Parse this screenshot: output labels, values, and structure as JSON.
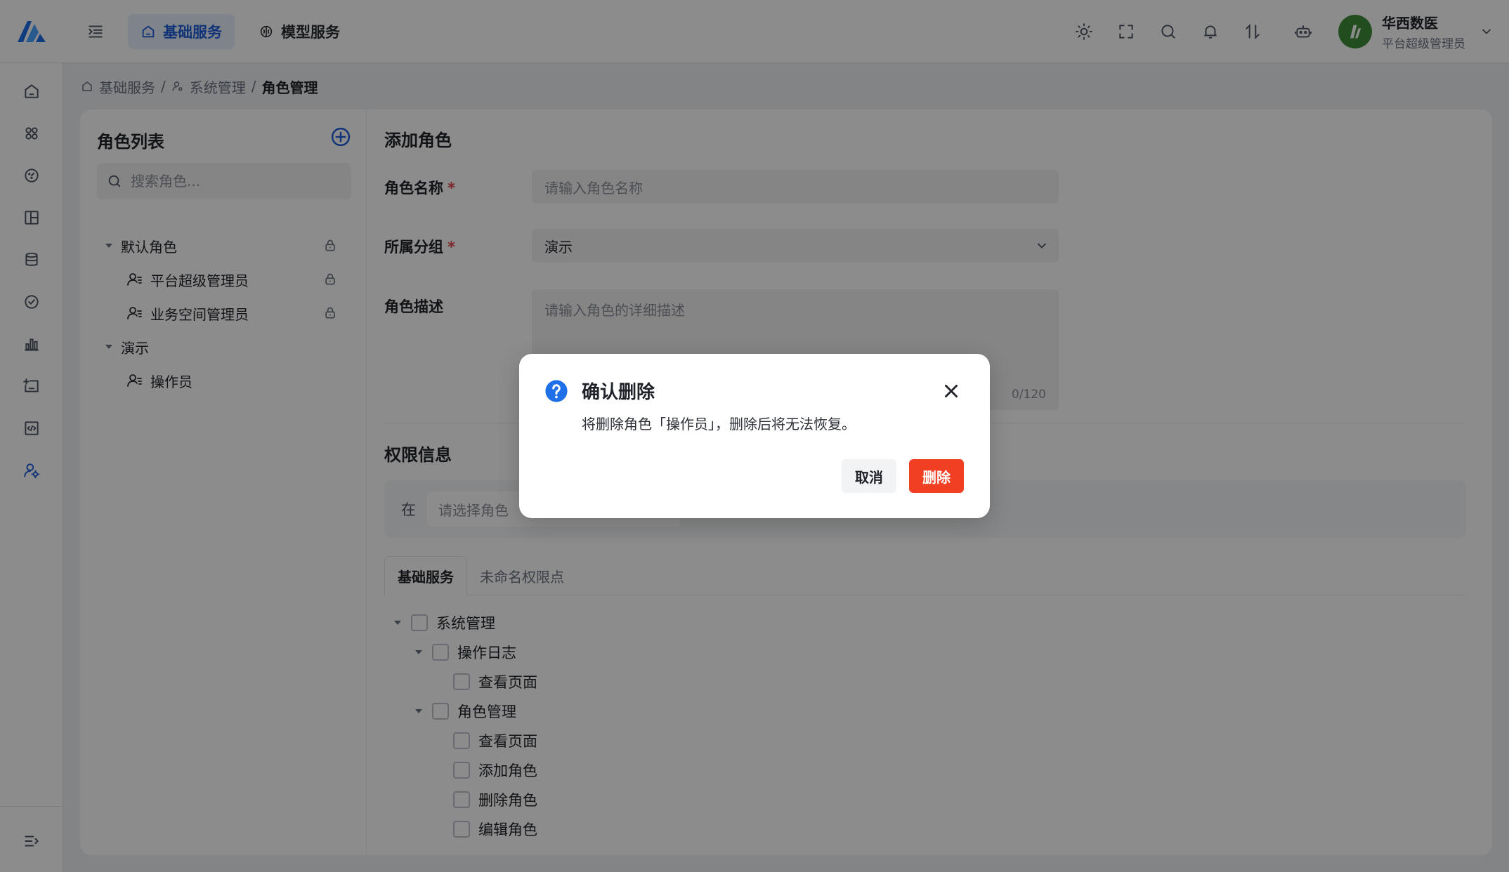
{
  "header": {
    "tabs": [
      {
        "label": "基础服务",
        "icon": "home-icon",
        "active": true
      },
      {
        "label": "模型服务",
        "icon": "brain-icon",
        "active": false
      }
    ],
    "user": {
      "name": "华西数医",
      "role": "平台超级管理员"
    }
  },
  "sidebar": {
    "icons": [
      "home-icon",
      "apps-icon",
      "dashboard-icon",
      "layout-icon",
      "database-icon",
      "check-circle-icon",
      "bar-chart-icon",
      "calendar-add-icon",
      "code-icon",
      "user-settings-icon"
    ]
  },
  "breadcrumb": {
    "items": [
      "基础服务",
      "系统管理",
      "角色管理"
    ],
    "separator": "/"
  },
  "role_list": {
    "title": "角色列表",
    "search_placeholder": "搜索角色...",
    "groups": [
      {
        "name": "默认角色",
        "locked": true,
        "roles": [
          {
            "name": "平台超级管理员",
            "locked": true
          },
          {
            "name": "业务空间管理员",
            "locked": true
          }
        ]
      },
      {
        "name": "演示",
        "locked": false,
        "roles": [
          {
            "name": "操作员",
            "locked": false
          }
        ]
      }
    ]
  },
  "form": {
    "title": "添加角色",
    "name_label": "角色名称",
    "name_placeholder": "请输入角色名称",
    "group_label": "所属分组",
    "group_value": "演示",
    "desc_label": "角色描述",
    "desc_placeholder": "请输入角色的详细描述",
    "desc_counter": "0/120",
    "required_mark": "*"
  },
  "permissions": {
    "title": "权限信息",
    "prefix": "在",
    "select_placeholder": "请选择角色",
    "tabs": [
      {
        "label": "基础服务",
        "active": true
      },
      {
        "label": "未命名权限点",
        "active": false
      }
    ],
    "tree": [
      {
        "label": "系统管理",
        "level": 0,
        "expandable": true
      },
      {
        "label": "操作日志",
        "level": 1,
        "expandable": true
      },
      {
        "label": "查看页面",
        "level": 2,
        "expandable": false
      },
      {
        "label": "角色管理",
        "level": 1,
        "expandable": true
      },
      {
        "label": "查看页面",
        "level": 2,
        "expandable": false
      },
      {
        "label": "添加角色",
        "level": 2,
        "expandable": false
      },
      {
        "label": "删除角色",
        "level": 2,
        "expandable": false
      },
      {
        "label": "编辑角色",
        "level": 2,
        "expandable": false
      }
    ]
  },
  "modal": {
    "title": "确认删除",
    "message": "将删除角色「操作员」，删除后将无法恢复。",
    "cancel_label": "取消",
    "confirm_label": "删除",
    "confirm_color": "#f03f23",
    "icon_color": "#1e6fe8"
  },
  "colors": {
    "accent": "#1e5fd9",
    "danger": "#f03f23"
  }
}
